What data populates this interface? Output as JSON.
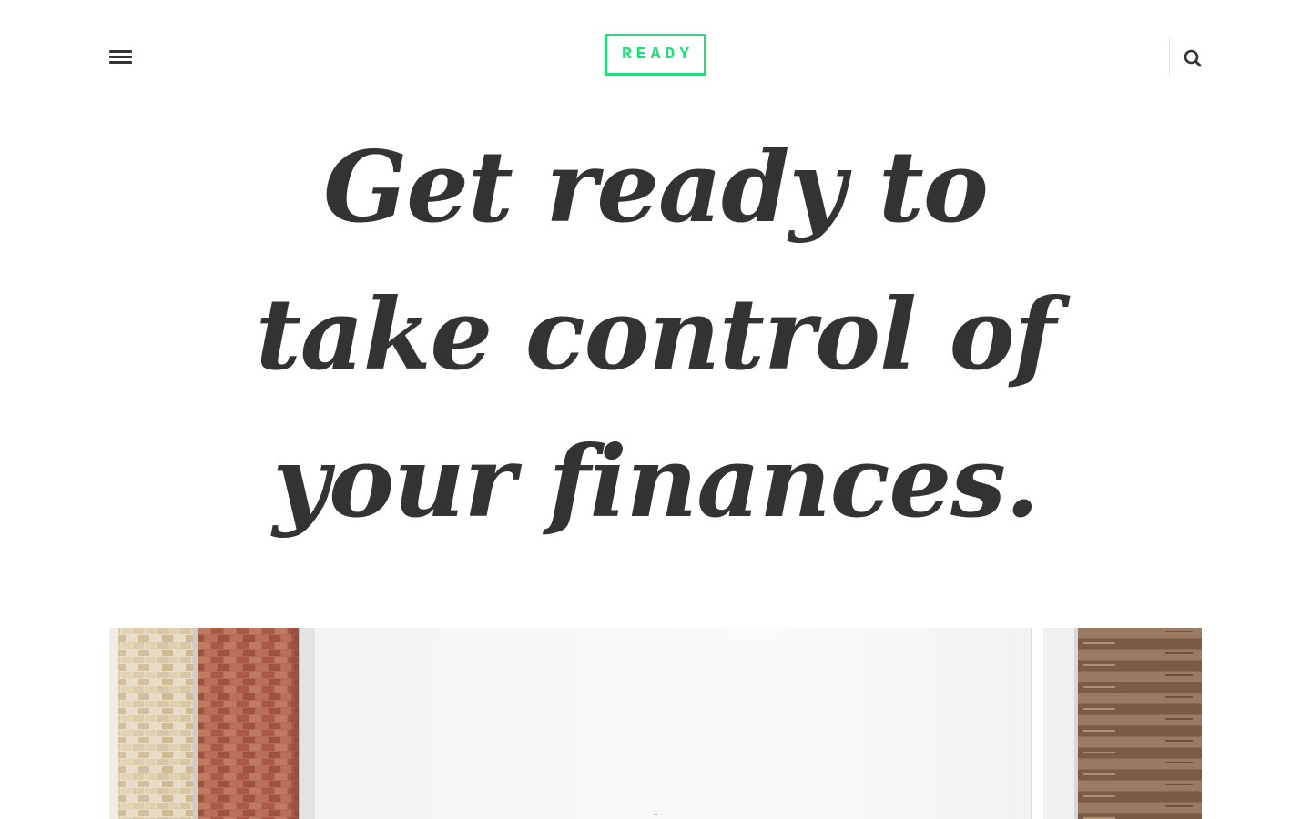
{
  "header": {
    "logo_text": "READY",
    "accent_color": "#1ee07a",
    "menu_icon": "hamburger-menu-icon",
    "search_icon": "search-icon"
  },
  "hero": {
    "title": "Get ready to take control of your finances."
  },
  "image": {
    "description_icon": "hero-photo"
  }
}
